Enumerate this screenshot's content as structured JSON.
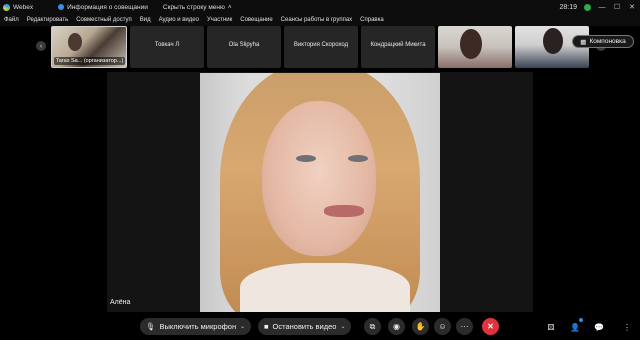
{
  "titlebar": {
    "app_name": "Webex",
    "meeting_info": "Информация о совещании",
    "hide_menu": "Скрыть строку меню",
    "clock": "28:19"
  },
  "menu": [
    "Файл",
    "Редактировать",
    "Совместный доступ",
    "Вид",
    "Аудио и видео",
    "Участник",
    "Совещание",
    "Сеансы работы в группах",
    "Справка"
  ],
  "filmstrip": {
    "tiles": [
      {
        "label": "Taras Sa... (организатор...)"
      },
      {
        "label": "Товкач Л"
      },
      {
        "label": "Ola Slipyha"
      },
      {
        "label": "Виктория Скороход"
      },
      {
        "label": "Кондрацкий Микита"
      }
    ],
    "layout_button": "Компоновка"
  },
  "stage": {
    "speaker_name": "Алёна"
  },
  "toolbar": {
    "mute_label": "Выключить микрофон",
    "video_label": "Остановить видео",
    "more_label": "···",
    "end_label": "✕"
  },
  "colors": {
    "end_call": "#e0333b",
    "recording": "#2fa84f",
    "accent": "#2f8be6"
  }
}
